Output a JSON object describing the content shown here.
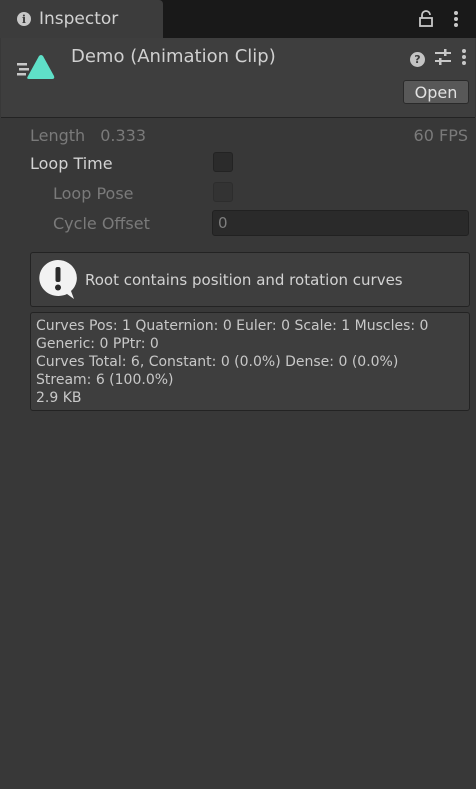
{
  "tab": {
    "label": "Inspector"
  },
  "header": {
    "title": "Demo (Animation Clip)",
    "open_label": "Open"
  },
  "clip": {
    "length_label": "Length",
    "length_value": "0.333",
    "fps": "60 FPS",
    "loop_time_label": "Loop Time",
    "loop_pose_label": "Loop Pose",
    "cycle_offset_label": "Cycle Offset",
    "cycle_offset_value": "0"
  },
  "warning": {
    "text": "Root contains position and rotation curves"
  },
  "info": {
    "lines": [
      "Curves Pos: 1 Quaternion: 0 Euler: 0 Scale: 1 Muscles: 0",
      "Generic: 0 PPtr: 0",
      "Curves Total: 6, Constant: 0 (0.0%) Dense: 0 (0.0%)",
      "Stream: 6 (100.0%)",
      "2.9 KB"
    ]
  },
  "colors": {
    "accent": "#5fe0c8",
    "background": "#383838"
  },
  "icons": [
    "info-icon",
    "lock-icon",
    "kebab-menu-icon",
    "animation-clip-icon",
    "help-icon",
    "preset-sliders-icon",
    "warning-icon"
  ]
}
